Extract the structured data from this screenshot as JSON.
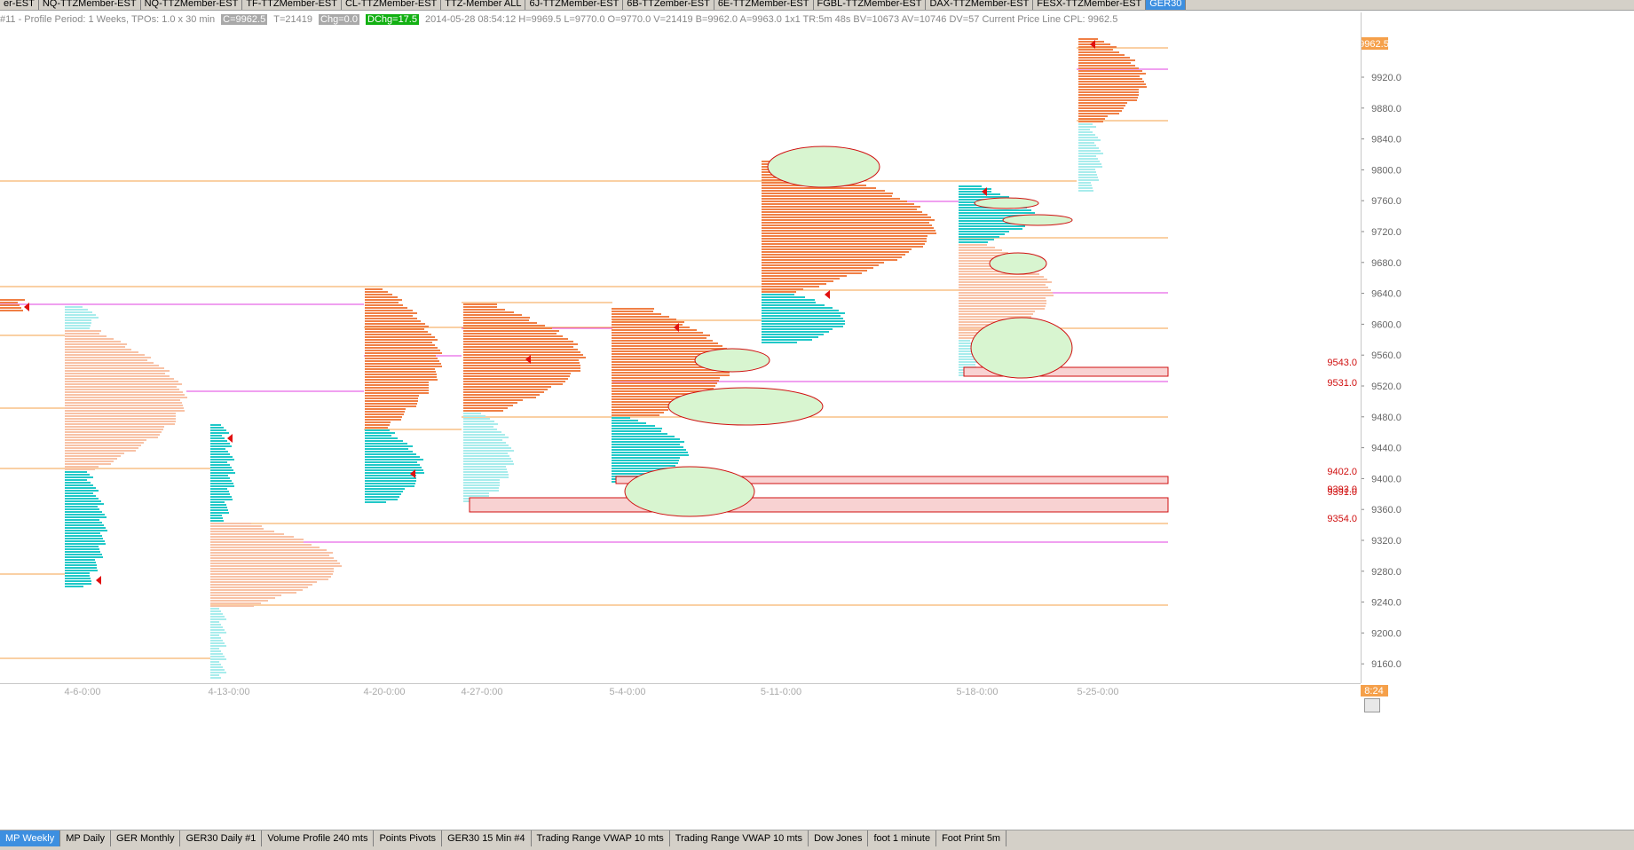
{
  "top_tabs": [
    "er-EST",
    "NQ-TTZMember-EST",
    "NQ-TTZMember-EST",
    "TF-TTZMember-EST",
    "CL-TTZMember-EST",
    "TTZ-Member ALL",
    "6J-TTZMember-EST",
    "6B-TTZember-EST",
    "6E-TTZMember-EST",
    "FGBL-TTZMember-EST",
    "DAX-TTZMember-EST",
    "FESX-TTZMember-EST",
    "GER30"
  ],
  "info_bar": {
    "title": "#11 - Profile Period: 1 Weeks, TPOs: 1.0 x 30 min",
    "close": "C=9962.5",
    "ticks": "T=21419",
    "chg": "Chg=0.0",
    "dchg": "DChg=17.5",
    "details": "2014-05-28 08:54:12 H=9969.5 L=9770.0 O=9770.0 V=21419 B=9962.0 A=9963.0 1x1 TR:5m 48s BV=10673 AV=10746 DV=57 Current Price Line  CPL: 9962.5"
  },
  "colors": {
    "orange_line": "#f5a04a",
    "magenta_line": "#e040e0",
    "profile_orange": "#f07f45",
    "profile_peach": "#f8c2a6",
    "profile_teal": "#20c8c8",
    "profile_lightteal": "#a8ecec",
    "zone_fill": "#f8d2d2",
    "zone_border": "#d01010",
    "ellipse_fill": "#d8f5d0",
    "ellipse_border": "#d01010",
    "last_price_bg": "#f5a04a"
  },
  "price_axis": {
    "ticks": [
      "9920.0",
      "9880.0",
      "9840.0",
      "9800.0",
      "9760.0",
      "9720.0",
      "9680.0",
      "9640.0",
      "9600.0",
      "9560.0",
      "9520.0",
      "9480.0",
      "9440.0",
      "9400.0",
      "9360.0",
      "9320.0",
      "9280.0",
      "9240.0",
      "9200.0",
      "9160.0"
    ],
    "last_price": "9962.5"
  },
  "zone_labels": [
    "9543.0",
    "9531.0",
    "9402.0",
    "9393.0",
    "9391.0",
    "9354.0"
  ],
  "date_labels": [
    "4-6-0:00",
    "4-13-0:00",
    "4-20-0:00",
    "4-27-0:00",
    "5-4-0:00",
    "5-11-0:00",
    "5-18-0:00",
    "5-25-0:00"
  ],
  "time_label": "8:24",
  "bottom_tabs": [
    "MP Weekly",
    "MP Daily",
    "GER Monthly",
    "GER30  Daily  #1",
    "Volume Profile 240 mts",
    "Points Pivots",
    "GER30  15 Min  #4",
    "Trading Range VWAP 10 mts",
    "Trading Range VWAP 10 mts",
    "Dow Jones",
    "foot 1 minute",
    "Foot Print 5m"
  ]
}
